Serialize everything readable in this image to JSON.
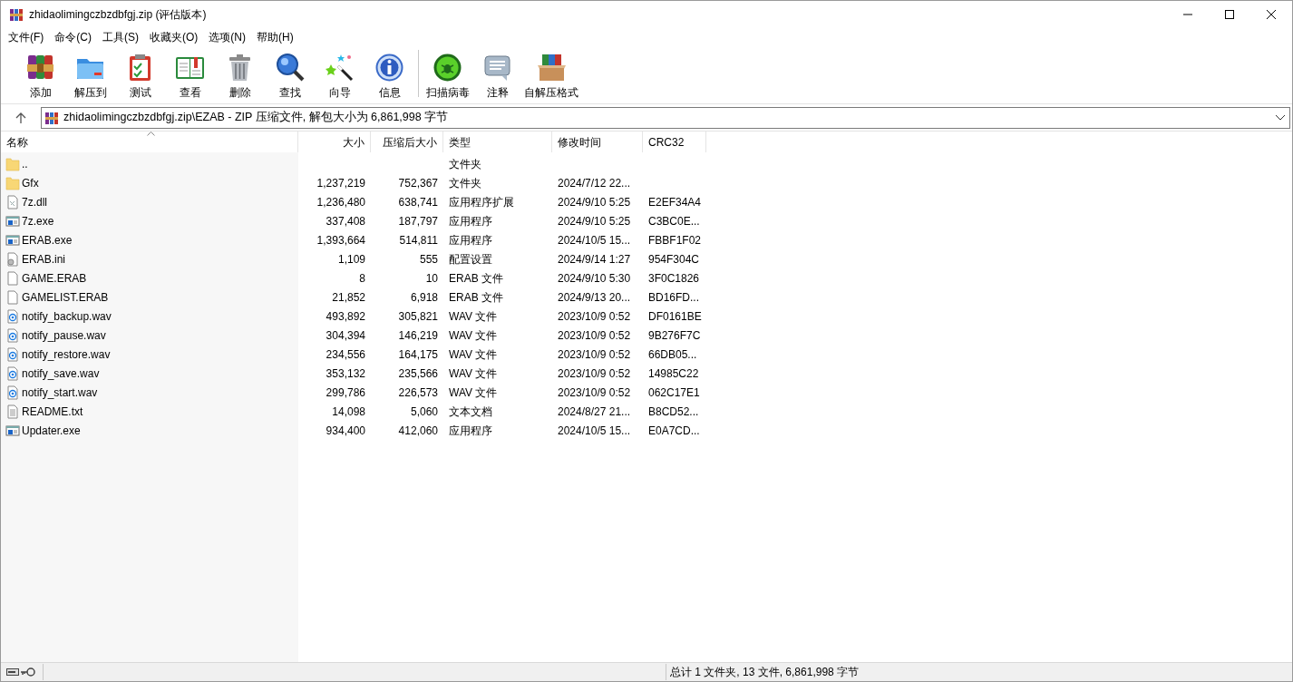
{
  "window": {
    "title": "zhidaolimingczbzdbfgj.zip (评估版本)"
  },
  "menu": [
    "文件(F)",
    "命令(C)",
    "工具(S)",
    "收藏夹(O)",
    "选项(N)",
    "帮助(H)"
  ],
  "toolbar": [
    {
      "label": "添加",
      "kind": "add"
    },
    {
      "label": "解压到",
      "kind": "extract"
    },
    {
      "label": "测试",
      "kind": "test"
    },
    {
      "label": "查看",
      "kind": "view"
    },
    {
      "label": "删除",
      "kind": "delete"
    },
    {
      "label": "查找",
      "kind": "find"
    },
    {
      "label": "向导",
      "kind": "wizard"
    },
    {
      "label": "信息",
      "kind": "info"
    },
    {
      "label": "扫描病毒",
      "kind": "scan",
      "separator_before": true
    },
    {
      "label": "注释",
      "kind": "comment"
    },
    {
      "label": "自解压格式",
      "kind": "sfx"
    }
  ],
  "address": {
    "path": "zhidaolimingczbzdbfgj.zip\\EZAB - ZIP 压缩文件, 解包大小为 6,861,998 字节"
  },
  "table": {
    "columns": [
      "名称",
      "大小",
      "压缩后大小",
      "类型",
      "修改时间",
      "CRC32"
    ],
    "rows": [
      {
        "kind": "folder",
        "name": "..",
        "size": "",
        "packed": "",
        "type": "文件夹",
        "modified": "",
        "crc": ""
      },
      {
        "kind": "folder",
        "name": "Gfx",
        "size": "1,237,219",
        "packed": "752,367",
        "type": "文件夹",
        "modified": "2024/7/12 22...",
        "crc": ""
      },
      {
        "kind": "dll",
        "name": "7z.dll",
        "size": "1,236,480",
        "packed": "638,741",
        "type": "应用程序扩展",
        "modified": "2024/9/10 5:25",
        "crc": "E2EF34A4"
      },
      {
        "kind": "exe",
        "name": "7z.exe",
        "size": "337,408",
        "packed": "187,797",
        "type": "应用程序",
        "modified": "2024/9/10 5:25",
        "crc": "C3BC0E..."
      },
      {
        "kind": "exe",
        "name": "ERAB.exe",
        "size": "1,393,664",
        "packed": "514,811",
        "type": "应用程序",
        "modified": "2024/10/5 15...",
        "crc": "FBBF1F02"
      },
      {
        "kind": "ini",
        "name": "ERAB.ini",
        "size": "1,109",
        "packed": "555",
        "type": "配置设置",
        "modified": "2024/9/14 1:27",
        "crc": "954F304C"
      },
      {
        "kind": "file",
        "name": "GAME.ERAB",
        "size": "8",
        "packed": "10",
        "type": "ERAB 文件",
        "modified": "2024/9/10 5:30",
        "crc": "3F0C1826"
      },
      {
        "kind": "file",
        "name": "GAMELIST.ERAB",
        "size": "21,852",
        "packed": "6,918",
        "type": "ERAB 文件",
        "modified": "2024/9/13 20...",
        "crc": "BD16FD..."
      },
      {
        "kind": "wav",
        "name": "notify_backup.wav",
        "size": "493,892",
        "packed": "305,821",
        "type": "WAV 文件",
        "modified": "2023/10/9 0:52",
        "crc": "DF0161BE"
      },
      {
        "kind": "wav",
        "name": "notify_pause.wav",
        "size": "304,394",
        "packed": "146,219",
        "type": "WAV 文件",
        "modified": "2023/10/9 0:52",
        "crc": "9B276F7C"
      },
      {
        "kind": "wav",
        "name": "notify_restore.wav",
        "size": "234,556",
        "packed": "164,175",
        "type": "WAV 文件",
        "modified": "2023/10/9 0:52",
        "crc": "66DB05..."
      },
      {
        "kind": "wav",
        "name": "notify_save.wav",
        "size": "353,132",
        "packed": "235,566",
        "type": "WAV 文件",
        "modified": "2023/10/9 0:52",
        "crc": "14985C22"
      },
      {
        "kind": "wav",
        "name": "notify_start.wav",
        "size": "299,786",
        "packed": "226,573",
        "type": "WAV 文件",
        "modified": "2023/10/9 0:52",
        "crc": "062C17E1"
      },
      {
        "kind": "txt",
        "name": "README.txt",
        "size": "14,098",
        "packed": "5,060",
        "type": "文本文档",
        "modified": "2024/8/27 21...",
        "crc": "B8CD52..."
      },
      {
        "kind": "exe",
        "name": "Updater.exe",
        "size": "934,400",
        "packed": "412,060",
        "type": "应用程序",
        "modified": "2024/10/5 15...",
        "crc": "E0A7CD..."
      }
    ]
  },
  "status_bar": {
    "summary": "总计 1 文件夹, 13 文件, 6,861,998 字节"
  }
}
